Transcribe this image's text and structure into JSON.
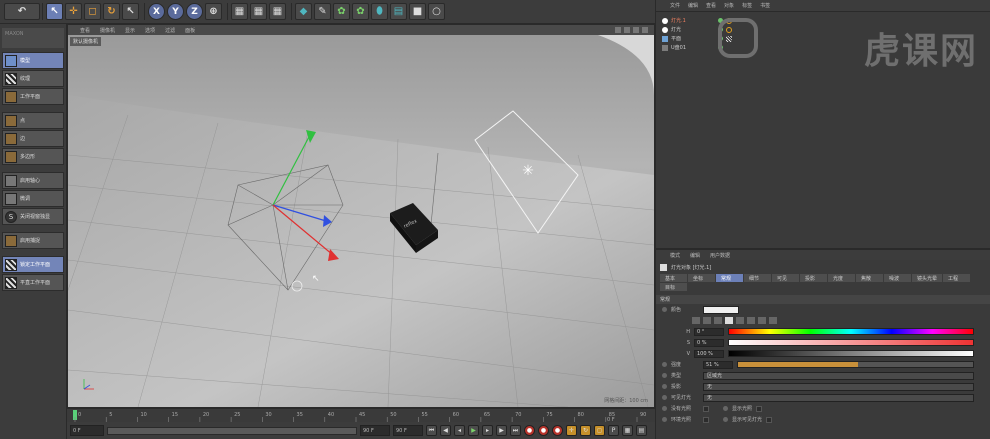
{
  "toolbar": {
    "axis_x": "X",
    "axis_y": "Y",
    "axis_z": "Z"
  },
  "left_palette": {
    "items": [
      {
        "label": "模型",
        "active": true
      },
      {
        "label": "纹理"
      },
      {
        "label": "工作平面"
      },
      {
        "label": "点"
      },
      {
        "label": "边"
      },
      {
        "label": "多边形"
      },
      {
        "label": "启用轴心"
      },
      {
        "label": "微调"
      },
      {
        "label": "关闭视窗独显"
      },
      {
        "label": "启用捕捉"
      },
      {
        "label": "锁定工作平面",
        "active": true
      },
      {
        "label": "平直工作平面"
      }
    ]
  },
  "viewport": {
    "menu": [
      "查看",
      "摄像机",
      "显示",
      "选项",
      "过滤",
      "面板"
    ],
    "camera_label": "默认摄像机",
    "status": "网格间距：100 cm",
    "object_label": "reflex"
  },
  "timeline": {
    "ticks": [
      "0",
      "5",
      "10",
      "15",
      "20",
      "25",
      "30",
      "35",
      "40",
      "45",
      "50",
      "55",
      "60",
      "65",
      "70",
      "75",
      "80",
      "85",
      "90"
    ],
    "current_frame": "0 F",
    "start_field": "0 F",
    "end_field": "90 F",
    "end_field2": "90 F"
  },
  "object_manager": {
    "menu": [
      "文件",
      "编辑",
      "查看",
      "对象",
      "标签",
      "书签"
    ],
    "objects": [
      {
        "name": "灯光.1",
        "type": "light",
        "selected": true
      },
      {
        "name": "灯光",
        "type": "light"
      },
      {
        "name": "平面",
        "type": "plane"
      },
      {
        "name": "U盘01",
        "type": "cube"
      }
    ],
    "watermark": "虎课网"
  },
  "attribute_manager": {
    "menu": [
      "模式",
      "编辑",
      "用户数据"
    ],
    "object_title": "灯光对象 [灯光.1]",
    "tabs": [
      {
        "label": "基本"
      },
      {
        "label": "坐标"
      },
      {
        "label": "常规",
        "active": true
      },
      {
        "label": "细节"
      },
      {
        "label": "可见"
      },
      {
        "label": "投影"
      },
      {
        "label": "光度"
      },
      {
        "label": "焦散"
      },
      {
        "label": "噪波"
      },
      {
        "label": "镜头光晕"
      },
      {
        "label": "工程"
      },
      {
        "label": "目标"
      }
    ],
    "section": "常规",
    "color_label": "颜色",
    "h": {
      "label": "H",
      "value": "0 °"
    },
    "s": {
      "label": "S",
      "value": "0 %"
    },
    "v": {
      "label": "V",
      "value": "100 %"
    },
    "strength": {
      "label": "强度",
      "value": "51 %",
      "fraction": 0.51
    },
    "type": {
      "label": "类型",
      "value": "区域光"
    },
    "shadow": {
      "label": "投影",
      "value": "无"
    },
    "visible_light": {
      "label": "可见灯光",
      "value": "无"
    },
    "no_illum": "没有光照",
    "show_illum": "显示光照",
    "env_light": "环境光照",
    "show_visible": "显示可见灯光"
  },
  "colors": {
    "accent": "#6c80b8",
    "x_axis": "#e03030",
    "y_axis": "#30c040",
    "z_axis": "#3050e0"
  }
}
